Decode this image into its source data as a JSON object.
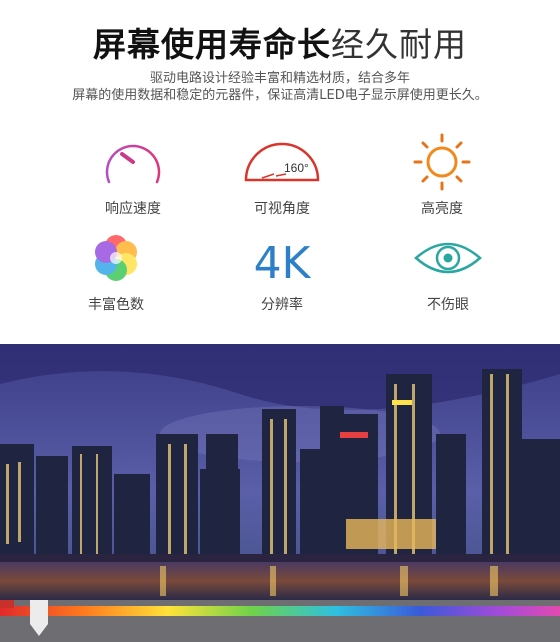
{
  "header": {
    "title_bold": "屏幕使用寿命长",
    "title_light": "经久耐用",
    "subtitle_line1": "驱动电路设计经验丰富和精选材质，结合多年",
    "subtitle_line2": "屏幕的使用数据和稳定的元器件，保证高清LED电子显示屏使用更长久。"
  },
  "features": [
    {
      "label": "响应速度",
      "icon": "speedometer-icon"
    },
    {
      "label": "可视角度",
      "icon": "viewing-angle-icon",
      "value": "160°"
    },
    {
      "label": "高亮度",
      "icon": "sun-icon"
    },
    {
      "label": "丰富色数",
      "icon": "color-flower-icon"
    },
    {
      "label": "分辨率",
      "icon": "resolution-4k-icon",
      "value": "4K"
    },
    {
      "label": "不伤眼",
      "icon": "eye-icon"
    }
  ],
  "colors": {
    "accent_red": "#d9352c",
    "sun_orange": "#f08a1c",
    "resolution_blue": "#2d80c8",
    "eye_teal": "#2aa7a1"
  }
}
